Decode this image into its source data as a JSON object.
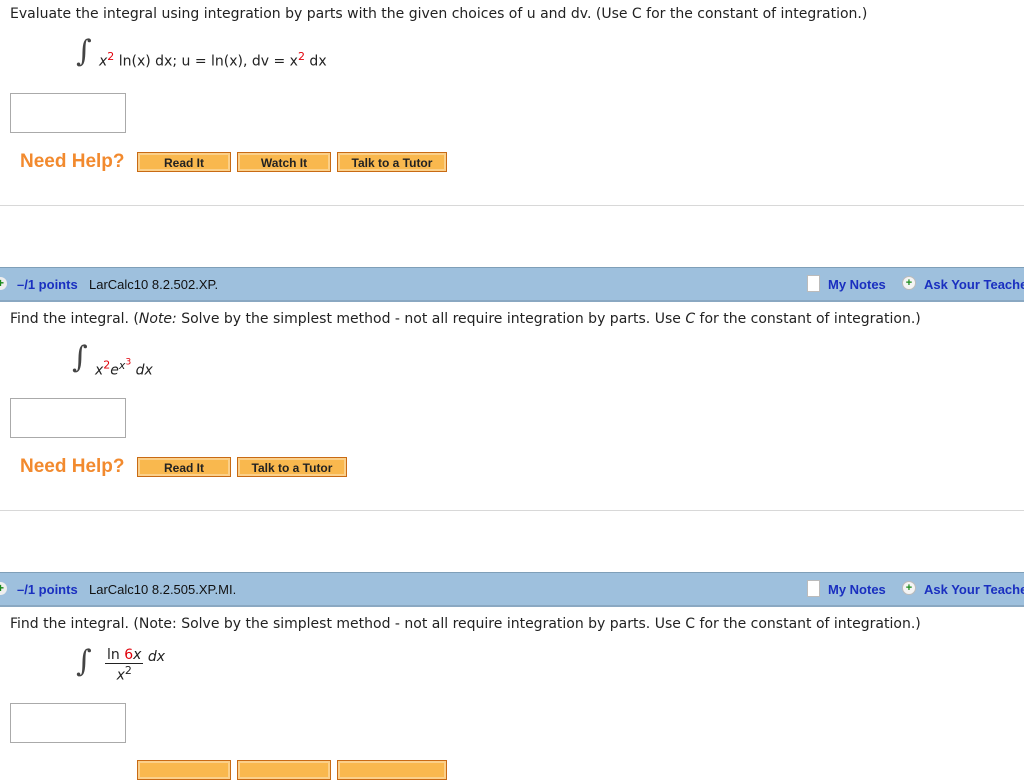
{
  "problem1": {
    "text": "Evaluate the integral using integration by parts with the given choices of u and dv. (Use C for the constant of integration.)",
    "expr": {
      "base": "x",
      "exp": "2",
      "rest": " ln(x) dx; u = ln(x), dv = x",
      "exp2": "2",
      "end": " dx"
    },
    "help_label": "Need Help?",
    "buttons": [
      "Read It",
      "Watch It",
      "Talk to a Tutor"
    ]
  },
  "problem2": {
    "points": "–/1 points",
    "code": "LarCalc10 8.2.502.XP.",
    "my_notes": "My Notes",
    "ask": "Ask Your Teacher",
    "text_a": "Find the integral. (",
    "text_note": "Note:",
    "text_b": " Solve by the simplest method - not all require integration by parts. Use ",
    "text_c": "C",
    "text_d": " for the constant of integration.)",
    "expr": {
      "x": "x",
      "x_exp": "2",
      "e": "e",
      "e_exp_base": "x",
      "e_exp_exp": "3",
      "dx": " dx"
    },
    "help_label": "Need Help?",
    "buttons": [
      "Read It",
      "Talk to a Tutor"
    ]
  },
  "problem3": {
    "points": "–/1 points",
    "code": "LarCalc10 8.2.505.XP.MI.",
    "my_notes": "My Notes",
    "ask": "Ask Your Teacher",
    "text": "Find the integral. (Note: Solve by the simplest method - not all require integration by parts. Use C for the constant of integration.)",
    "expr": {
      "ln": "ln ",
      "coef": "6",
      "var": "x",
      "den": "x",
      "den_exp": "2",
      "dx": "dx"
    }
  },
  "colors": {
    "header_bg": "#9ec0dd",
    "help": "#f28a2e",
    "button": "#f9b84e",
    "link": "#1a2fc0",
    "highlight": "#e0000a"
  }
}
